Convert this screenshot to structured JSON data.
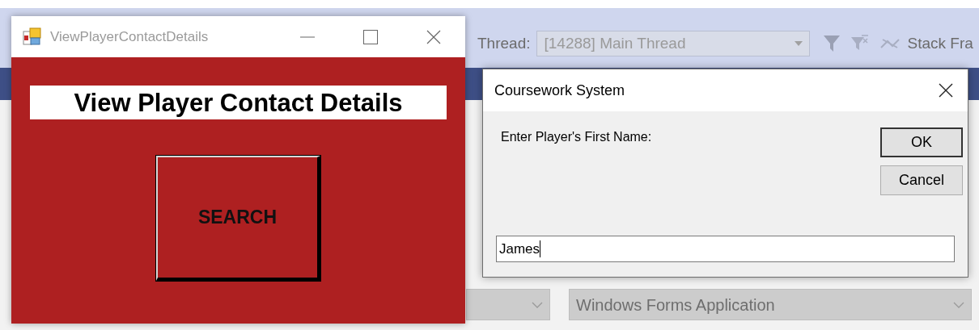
{
  "background_ide": {
    "thread_label": "Thread:",
    "thread_dropdown": "[14288] Main Thread",
    "stack_frame_label": "Stack Fra",
    "application_type_dropdown": "Windows Forms Application"
  },
  "form_window": {
    "title": "ViewPlayerContactDetails",
    "heading": "View Player Contact Details",
    "search_button": "SEARCH"
  },
  "dialog": {
    "title": "Coursework System",
    "prompt": "Enter Player's First Name:",
    "buttons": [
      {
        "label": "OK",
        "default": true
      },
      {
        "label": "Cancel",
        "default": false
      }
    ],
    "input": {
      "value": "James",
      "focused": true
    }
  }
}
